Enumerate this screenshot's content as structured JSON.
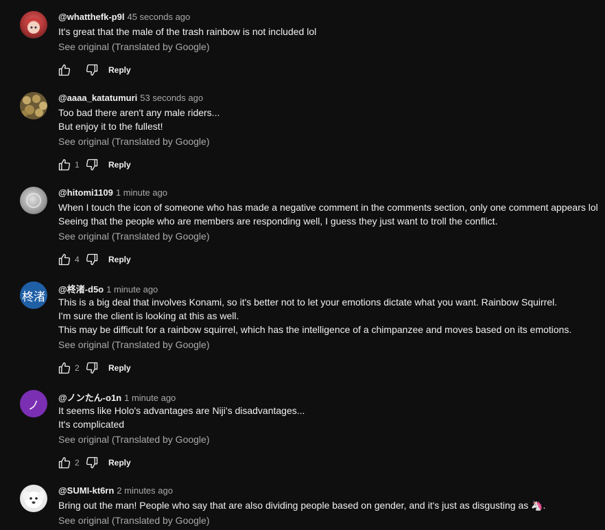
{
  "comments": [
    {
      "author": "@whatthefk-p9l",
      "time": "45 seconds ago",
      "lines": [
        "It's great that the male of the trash rainbow is not included lol"
      ],
      "see_original": "See original (Translated by Google)",
      "likes": "",
      "reply": "Reply",
      "avatar": {
        "type": "image",
        "colors": [
          "#7a2a2a",
          "#d94848"
        ]
      }
    },
    {
      "author": "@aaaa_katatumuri",
      "time": "53 seconds ago",
      "lines": [
        "Too bad there aren't any male riders...",
        "But enjoy it to the fullest!"
      ],
      "see_original": "See original (Translated by Google)",
      "likes": "1",
      "reply": "Reply",
      "avatar": {
        "type": "image",
        "colors": [
          "#5b4a2a",
          "#b59a5a"
        ]
      }
    },
    {
      "author": "@hitomi1109",
      "time": "1 minute ago",
      "lines": [
        "When I touch the icon of someone who has made a negative comment in the comments section, only one comment appears lol",
        "Seeing that the people who are members are responding well, I guess they just want to troll the conflict."
      ],
      "see_original": "See original (Translated by Google)",
      "likes": "4",
      "reply": "Reply",
      "avatar": {
        "type": "image",
        "colors": [
          "#8a8a8a",
          "#c9c9c9"
        ]
      }
    },
    {
      "author": "@柊渚-d5o",
      "time": "1 minute ago",
      "lines": [
        "This is a big deal that involves Konami, so it's better not to let your emotions dictate what you want. Rainbow Squirrel.",
        "I'm sure the client is looking at this as well.",
        "This may be difficult for a rainbow squirrel, which has the intelligence of a chimpanzee and moves based on its emotions."
      ],
      "see_original": "See original (Translated by Google)",
      "likes": "2",
      "reply": "Reply",
      "avatar": {
        "type": "letter",
        "text": "柊渚",
        "bg": "#1f5fa6"
      }
    },
    {
      "author": "@ノンたん-o1n",
      "time": "1 minute ago",
      "lines": [
        "It seems like Holo's advantages are Niji's disadvantages...",
        "It's complicated"
      ],
      "see_original": "See original (Translated by Google)",
      "likes": "2",
      "reply": "Reply",
      "avatar": {
        "type": "letter",
        "text": "ノ",
        "bg": "#7b2fb3"
      }
    },
    {
      "author": "@SUMI-kt6rn",
      "time": "2 minutes ago",
      "lines": [
        "Bring out the man! People who say that are also dividing people based on gender, and it's just as disgusting as 🦄."
      ],
      "see_original": "See original (Translated by Google)",
      "likes": "",
      "reply": "Reply",
      "avatar": {
        "type": "image",
        "colors": [
          "#d8d8d8",
          "#ffffff"
        ]
      }
    }
  ]
}
